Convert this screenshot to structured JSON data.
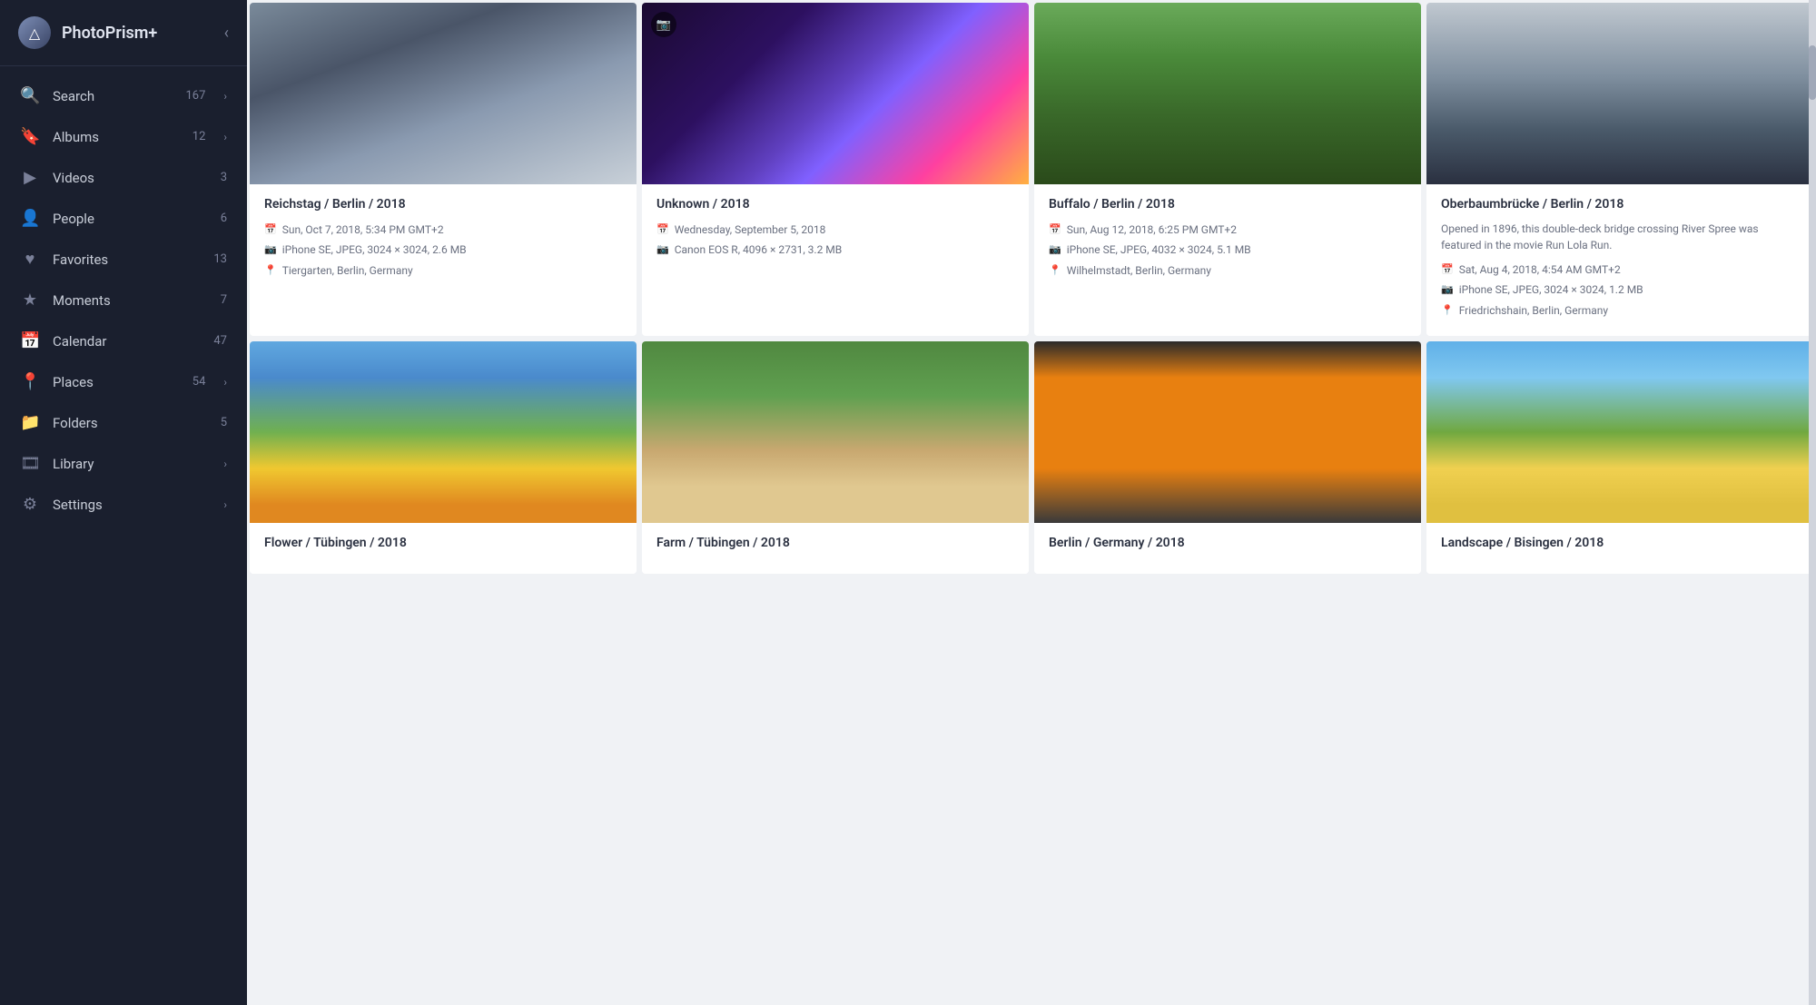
{
  "app": {
    "name": "PhotoPrism+",
    "logo_symbol": "△"
  },
  "sidebar": {
    "collapse_icon": "◀",
    "items": [
      {
        "id": "search",
        "label": "Search",
        "count": "167",
        "icon": "🔍",
        "has_chevron": true
      },
      {
        "id": "albums",
        "label": "Albums",
        "count": "12",
        "icon": "🔖",
        "has_chevron": true
      },
      {
        "id": "videos",
        "label": "Videos",
        "count": "3",
        "icon": "▶",
        "has_chevron": false
      },
      {
        "id": "people",
        "label": "People",
        "count": "6",
        "icon": "👤",
        "has_chevron": false
      },
      {
        "id": "favorites",
        "label": "Favorites",
        "count": "13",
        "icon": "♥",
        "has_chevron": false
      },
      {
        "id": "moments",
        "label": "Moments",
        "count": "7",
        "icon": "★",
        "has_chevron": false
      },
      {
        "id": "calendar",
        "label": "Calendar",
        "count": "47",
        "icon": "📅",
        "has_chevron": false
      },
      {
        "id": "places",
        "label": "Places",
        "count": "54",
        "icon": "📍",
        "has_chevron": true
      },
      {
        "id": "folders",
        "label": "Folders",
        "count": "5",
        "icon": "📁",
        "has_chevron": false
      },
      {
        "id": "library",
        "label": "Library",
        "count": "",
        "icon": "🎞",
        "has_chevron": true
      },
      {
        "id": "settings",
        "label": "Settings",
        "count": "",
        "icon": "⚙",
        "has_chevron": true
      }
    ]
  },
  "photos": [
    {
      "id": "reichstag",
      "title": "Reichstag / Berlin / 2018",
      "date": "Sun, Oct 7, 2018, 5:34 PM GMT+2",
      "camera": "iPhone SE, JPEG, 3024 × 3024, 2.6 MB",
      "location": "Tiergarten, Berlin, Germany",
      "description": "",
      "has_camera_badge": false,
      "img_class": "img-reichstag"
    },
    {
      "id": "unknown",
      "title": "Unknown / 2018",
      "date": "Wednesday, September 5, 2018",
      "camera": "Canon EOS R, 4096 × 2731, 3.2 MB",
      "location": "",
      "description": "",
      "has_camera_badge": true,
      "img_class": "img-unknown"
    },
    {
      "id": "buffalo",
      "title": "Buffalo / Berlin / 2018",
      "date": "Sun, Aug 12, 2018, 6:25 PM GMT+2",
      "camera": "iPhone SE, JPEG, 4032 × 3024, 5.1 MB",
      "location": "Wilhelmstadt, Berlin, Germany",
      "description": "",
      "has_camera_badge": false,
      "img_class": "img-buffalo"
    },
    {
      "id": "oberbaum",
      "title": "Oberbaumbrücke / Berlin / 2018",
      "date": "Sat, Aug 4, 2018, 4:54 AM GMT+2",
      "camera": "iPhone SE, JPEG, 3024 × 3024, 1.2 MB",
      "location": "Friedrichshain, Berlin, Germany",
      "description": "Opened in 1896, this double-deck bridge crossing River Spree was featured in the movie Run Lola Run.",
      "has_camera_badge": false,
      "img_class": "img-oberbaum"
    },
    {
      "id": "flower",
      "title": "Flower / Tübingen / 2018",
      "date": "",
      "camera": "",
      "location": "",
      "description": "",
      "has_camera_badge": false,
      "img_class": "img-flower"
    },
    {
      "id": "farm",
      "title": "Farm / Tübingen / 2018",
      "date": "",
      "camera": "",
      "location": "",
      "description": "",
      "has_camera_badge": false,
      "img_class": "img-farm"
    },
    {
      "id": "berlin-graffiti",
      "title": "Berlin / Germany / 2018",
      "date": "",
      "camera": "",
      "location": "",
      "description": "",
      "has_camera_badge": false,
      "img_class": "img-berlin-graffiti"
    },
    {
      "id": "landscape",
      "title": "Landscape / Bisingen / 2018",
      "date": "",
      "camera": "",
      "location": "",
      "description": "",
      "has_camera_badge": false,
      "img_class": "img-landscape"
    }
  ],
  "icons": {
    "search": "🔍",
    "bookmark": "🔖",
    "play": "▶",
    "person": "👤",
    "heart": "♥",
    "star": "★",
    "calendar": "📅",
    "pin": "📍",
    "folder": "📁",
    "film": "🎞",
    "gear": "⚙",
    "camera": "📷",
    "chevron_right": "›",
    "chevron_left": "‹",
    "heart_outline": "♡"
  }
}
